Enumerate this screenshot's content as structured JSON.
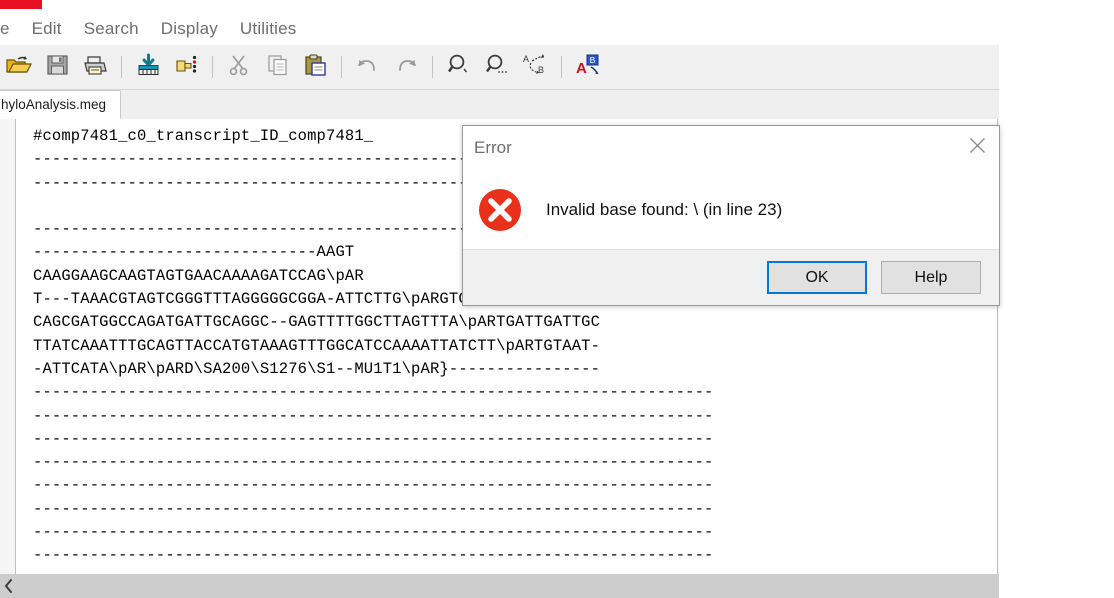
{
  "window": {
    "close_button_color": "#e81123"
  },
  "menubar": {
    "items": [
      {
        "label": "ile",
        "name": "menu-file"
      },
      {
        "label": "Edit",
        "name": "menu-edit"
      },
      {
        "label": "Search",
        "name": "menu-search"
      },
      {
        "label": "Display",
        "name": "menu-display"
      },
      {
        "label": "Utilities",
        "name": "menu-utilities"
      }
    ]
  },
  "toolbar": {
    "buttons": [
      {
        "icon": "open-folder-icon",
        "name": "open-file-button"
      },
      {
        "icon": "floppy-disk-icon",
        "name": "save-file-button"
      },
      {
        "icon": "printer-icon",
        "name": "print-button"
      },
      {
        "icon": "sep",
        "name": "toolbar-separator-1"
      },
      {
        "icon": "export-data-icon",
        "name": "export-data-button"
      },
      {
        "icon": "select-pointer-icon",
        "name": "select-data-button"
      },
      {
        "icon": "sep",
        "name": "toolbar-separator-2"
      },
      {
        "icon": "scissors-icon",
        "name": "cut-button"
      },
      {
        "icon": "copy-icon",
        "name": "copy-button"
      },
      {
        "icon": "clipboard-paste-icon",
        "name": "paste-button"
      },
      {
        "icon": "sep",
        "name": "toolbar-separator-3"
      },
      {
        "icon": "undo-arrow-icon",
        "name": "undo-button"
      },
      {
        "icon": "redo-arrow-icon",
        "name": "redo-button"
      },
      {
        "icon": "sep",
        "name": "toolbar-separator-4"
      },
      {
        "icon": "magnifier-find-icon",
        "name": "find-button"
      },
      {
        "icon": "magnifier-find-next-icon",
        "name": "find-next-button"
      },
      {
        "icon": "replace-a-b-icon",
        "name": "replace-button"
      },
      {
        "icon": "sep",
        "name": "toolbar-separator-5"
      },
      {
        "icon": "translate-font-icon",
        "name": "translate-button"
      }
    ]
  },
  "tabs": {
    "active": "hyloAnalysis.meg"
  },
  "editor": {
    "lines": [
      "#comp7481_c0_transcript_ID_comp7481_",
      "------------------------------------------------------------------------",
      "------------------------------------------------------------------------",
      "",
      "------------------------------------------------------------------------",
      "------------------------------AAGT",
      "CAAGGAAGCAAGTAGTGAACAAAAGATCCAG\\pAR",
      "T---TAAACGTAGTCGGGTTTAGGGGGCGGA-ATTCTTG\\pARGTGAAATAAGAAAGAAG",
      "CAGCGATGGCCAGATGATTGCAGGC--GAGTTTTGGCTTAGTTTA\\pARTGATTGATTGC",
      "TTATCAAATTTGCAGTTACCATGTAAAGTTTGGCATCCAAAATTATCTT\\pARTGTAAT-",
      "-ATTCATA\\pAR\\pARD\\SA200\\S1276\\S1--MU1T1\\pAR}----------------",
      "------------------------------------------------------------------------",
      "------------------------------------------------------------------------",
      "------------------------------------------------------------------------",
      "------------------------------------------------------------------------",
      "------------------------------------------------------------------------",
      "------------------------------------------------------------------------",
      "------------------------------------------------------------------------",
      "------------------------------------------------------------------------"
    ]
  },
  "scrollbar": {
    "left_arrow_glyph": "❮"
  },
  "dialog": {
    "title": "Error",
    "message": "Invalid base found: \\ (in line 23)",
    "icon": "error-circle-x-icon",
    "close_glyph": "×",
    "buttons": [
      {
        "label": "OK",
        "name": "ok-button",
        "default": true
      },
      {
        "label": "Help",
        "name": "help-button",
        "default": false
      }
    ],
    "accent_color": "#0078d7",
    "error_color": "#e8301a"
  }
}
